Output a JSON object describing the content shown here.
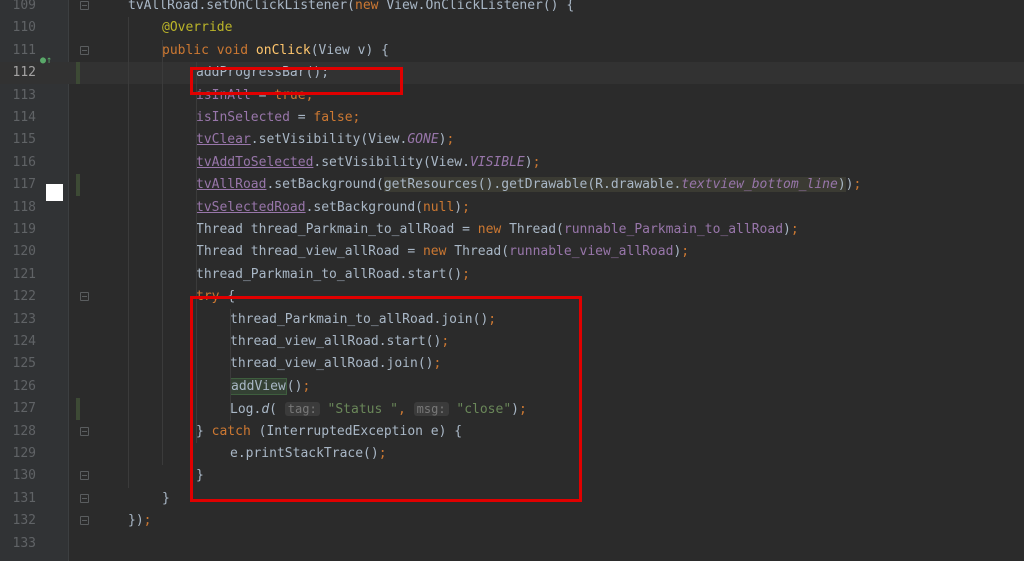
{
  "editor": {
    "lines": [
      {
        "n": "109",
        "indent": 1,
        "current": false,
        "fold": true,
        "tokens": [
          [
            "",
            "tvAllRoad"
          ],
          [
            "",
            ".setOnClickListener("
          ],
          [
            "kw",
            "new "
          ],
          [
            "",
            "View.OnClickListener() {"
          ]
        ]
      },
      {
        "n": "110",
        "indent": 2,
        "current": false,
        "fold": false,
        "tokens": [
          [
            "ann",
            "@Override"
          ]
        ]
      },
      {
        "n": "111",
        "indent": 2,
        "current": false,
        "fold": true,
        "tokens": [
          [
            "kw",
            "public void "
          ],
          [
            "fn",
            "onClick"
          ],
          [
            "",
            "(View v) {"
          ]
        ]
      },
      {
        "n": "112",
        "indent": 3,
        "current": true,
        "fold": false,
        "tokens": [
          [
            "",
            "addProgressBar();"
          ]
        ]
      },
      {
        "n": "113",
        "indent": 3,
        "current": false,
        "fold": false,
        "tokens": [
          [
            "field",
            "isInAll"
          ],
          [
            "",
            " = "
          ],
          [
            "kw",
            "true"
          ],
          [
            "kw",
            ";"
          ]
        ]
      },
      {
        "n": "114",
        "indent": 3,
        "current": false,
        "fold": false,
        "tokens": [
          [
            "field",
            "isInSelected"
          ],
          [
            "",
            " = "
          ],
          [
            "kw",
            "false"
          ],
          [
            "kw",
            ";"
          ]
        ]
      },
      {
        "n": "115",
        "indent": 3,
        "current": false,
        "fold": false,
        "tokens": [
          [
            "field ul",
            "tvClear"
          ],
          [
            "",
            ".setVisibility(View."
          ],
          [
            "ifield",
            "GONE"
          ],
          [
            "",
            ")"
          ],
          [
            "kw",
            ";"
          ]
        ]
      },
      {
        "n": "116",
        "indent": 3,
        "current": false,
        "fold": false,
        "tokens": [
          [
            "field ul",
            "tvAddToSelected"
          ],
          [
            "",
            ".setVisibility(View."
          ],
          [
            "ifield",
            "VISIBLE"
          ],
          [
            "",
            ")"
          ],
          [
            "kw",
            ";"
          ]
        ]
      },
      {
        "n": "117",
        "indent": 3,
        "current": false,
        "fold": false,
        "tokens": [
          [
            "field ul",
            "tvAllRoad"
          ],
          [
            "",
            ".setBackground("
          ],
          [
            "warn",
            "getResources().getDrawable(R.drawable."
          ],
          [
            "warnitalic",
            "textview_bottom_line"
          ],
          [
            "warn",
            ")"
          ],
          [
            "",
            ")"
          ],
          [
            "kw",
            ";"
          ]
        ]
      },
      {
        "n": "118",
        "indent": 3,
        "current": false,
        "fold": false,
        "tokens": [
          [
            "field ul",
            "tvSelectedRoad"
          ],
          [
            "",
            ".setBackground("
          ],
          [
            "kw",
            "null"
          ],
          [
            "",
            ")"
          ],
          [
            "kw",
            ";"
          ]
        ]
      },
      {
        "n": "119",
        "indent": 3,
        "current": false,
        "fold": false,
        "tokens": [
          [
            "",
            "Thread thread_Parkmain_to_allRoad = "
          ],
          [
            "kw",
            "new "
          ],
          [
            "",
            "Thread("
          ],
          [
            "field",
            "runnable_Parkmain_to_allRoad"
          ],
          [
            "",
            ")"
          ],
          [
            "kw",
            ";"
          ]
        ]
      },
      {
        "n": "120",
        "indent": 3,
        "current": false,
        "fold": false,
        "tokens": [
          [
            "",
            "Thread thread_view_allRoad = "
          ],
          [
            "kw",
            "new "
          ],
          [
            "",
            "Thread("
          ],
          [
            "field",
            "runnable_view_allRoad"
          ],
          [
            "",
            ")"
          ],
          [
            "kw",
            ";"
          ]
        ]
      },
      {
        "n": "121",
        "indent": 3,
        "current": false,
        "fold": false,
        "tokens": [
          [
            "",
            "thread_Parkmain_to_allRoad.start()"
          ],
          [
            "kw",
            ";"
          ]
        ]
      },
      {
        "n": "122",
        "indent": 3,
        "current": false,
        "fold": true,
        "tokens": [
          [
            "kw",
            "try "
          ],
          [
            "",
            "{"
          ]
        ]
      },
      {
        "n": "123",
        "indent": 4,
        "current": false,
        "fold": false,
        "tokens": [
          [
            "",
            "thread_Parkmain_to_allRoad.join()"
          ],
          [
            "kw",
            ";"
          ]
        ]
      },
      {
        "n": "124",
        "indent": 4,
        "current": false,
        "fold": false,
        "tokens": [
          [
            "",
            "thread_view_allRoad.start()"
          ],
          [
            "kw",
            ";"
          ]
        ]
      },
      {
        "n": "125",
        "indent": 4,
        "current": false,
        "fold": false,
        "tokens": [
          [
            "",
            "thread_view_allRoad.join()"
          ],
          [
            "kw",
            ";"
          ]
        ]
      },
      {
        "n": "126",
        "indent": 4,
        "current": false,
        "fold": false,
        "tokens": [
          [
            "hl",
            "addView"
          ],
          [
            "",
            "()"
          ],
          [
            "kw",
            ";"
          ]
        ]
      },
      {
        "n": "127",
        "indent": 4,
        "current": false,
        "fold": false,
        "tokens": [
          [
            "",
            "Log."
          ],
          [
            "ifn",
            "d"
          ],
          [
            "",
            "( "
          ],
          [
            "hint",
            "tag:"
          ],
          [
            "str",
            " \"Status \""
          ],
          [
            "kw",
            ", "
          ],
          [
            "hint",
            "msg:"
          ],
          [
            "str",
            " \"close\""
          ],
          [
            "",
            ")"
          ],
          [
            "kw",
            ";"
          ]
        ]
      },
      {
        "n": "128",
        "indent": 3,
        "current": false,
        "fold": true,
        "tokens": [
          [
            "",
            "} "
          ],
          [
            "kw",
            "catch "
          ],
          [
            "",
            "(InterruptedException e) {"
          ]
        ]
      },
      {
        "n": "129",
        "indent": 4,
        "current": false,
        "fold": false,
        "tokens": [
          [
            "",
            "e.printStackTrace()"
          ],
          [
            "kw",
            ";"
          ]
        ]
      },
      {
        "n": "130",
        "indent": 3,
        "current": false,
        "fold": true,
        "tokens": [
          [
            "",
            "}"
          ]
        ]
      },
      {
        "n": "131",
        "indent": 2,
        "current": false,
        "fold": true,
        "tokens": [
          [
            "",
            "}"
          ]
        ]
      },
      {
        "n": "132",
        "indent": 1,
        "current": false,
        "fold": true,
        "tokens": [
          [
            "",
            "})"
          ],
          [
            "kw",
            ";"
          ]
        ]
      },
      {
        "n": "133",
        "indent": 0,
        "current": false,
        "fold": false,
        "tokens": []
      }
    ],
    "colors": {
      "background": "#2b2b2b",
      "keyword": "#cc7832",
      "string": "#6a8759",
      "field": "#9876aa",
      "method": "#ffc66d",
      "annotation": "#bbb529",
      "annotation_box": "#e00000"
    },
    "gutter_icons": [
      "override-icon",
      "bookmark-icon"
    ]
  }
}
